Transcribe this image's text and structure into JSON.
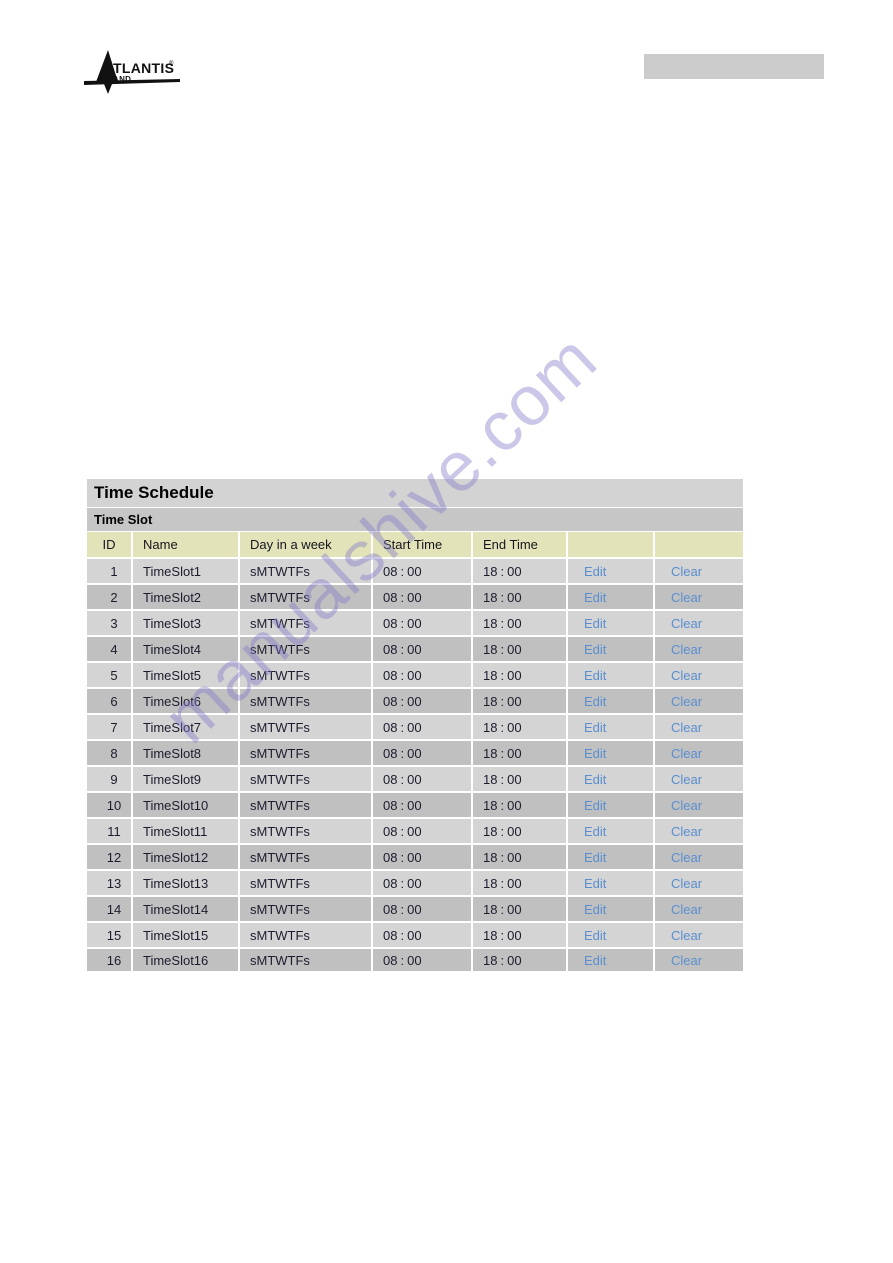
{
  "header": {
    "logo": {
      "icon": "atlantis-land-logo",
      "brand_primary": "ATLANTIS",
      "brand_registered": "®",
      "brand_secondary": "LAND"
    },
    "gray_bar_color": "#cccccc"
  },
  "watermark": {
    "text": "manualshive.com",
    "color": "#807aca"
  },
  "panel": {
    "title": "Time Schedule",
    "subtitle": "Time Slot",
    "title_bg": "#d3d3d3",
    "subtitle_bg": "#c6c6c6",
    "header_bg": "#e3e3ba",
    "row_odd_bg": "#d4d4d4",
    "row_even_bg": "#c0c0c0",
    "link_color": "#5a8ed0"
  },
  "table": {
    "columns": [
      {
        "key": "id",
        "label": "ID"
      },
      {
        "key": "name",
        "label": "Name"
      },
      {
        "key": "day",
        "label": "Day in a week"
      },
      {
        "key": "start",
        "label": "Start Time"
      },
      {
        "key": "end",
        "label": "End Time"
      },
      {
        "key": "edit",
        "label": ""
      },
      {
        "key": "clear",
        "label": ""
      }
    ],
    "actions": {
      "edit_label": "Edit",
      "clear_label": "Clear"
    },
    "time_separator": ":",
    "rows": [
      {
        "id": "1",
        "name": "TimeSlot1",
        "day": "sMTWTFs",
        "start_h": "08",
        "start_m": "00",
        "end_h": "18",
        "end_m": "00"
      },
      {
        "id": "2",
        "name": "TimeSlot2",
        "day": "sMTWTFs",
        "start_h": "08",
        "start_m": "00",
        "end_h": "18",
        "end_m": "00"
      },
      {
        "id": "3",
        "name": "TimeSlot3",
        "day": "sMTWTFs",
        "start_h": "08",
        "start_m": "00",
        "end_h": "18",
        "end_m": "00"
      },
      {
        "id": "4",
        "name": "TimeSlot4",
        "day": "sMTWTFs",
        "start_h": "08",
        "start_m": "00",
        "end_h": "18",
        "end_m": "00"
      },
      {
        "id": "5",
        "name": "TimeSlot5",
        "day": "sMTWTFs",
        "start_h": "08",
        "start_m": "00",
        "end_h": "18",
        "end_m": "00"
      },
      {
        "id": "6",
        "name": "TimeSlot6",
        "day": "sMTWTFs",
        "start_h": "08",
        "start_m": "00",
        "end_h": "18",
        "end_m": "00"
      },
      {
        "id": "7",
        "name": "TimeSlot7",
        "day": "sMTWTFs",
        "start_h": "08",
        "start_m": "00",
        "end_h": "18",
        "end_m": "00"
      },
      {
        "id": "8",
        "name": "TimeSlot8",
        "day": "sMTWTFs",
        "start_h": "08",
        "start_m": "00",
        "end_h": "18",
        "end_m": "00"
      },
      {
        "id": "9",
        "name": "TimeSlot9",
        "day": "sMTWTFs",
        "start_h": "08",
        "start_m": "00",
        "end_h": "18",
        "end_m": "00"
      },
      {
        "id": "10",
        "name": "TimeSlot10",
        "day": "sMTWTFs",
        "start_h": "08",
        "start_m": "00",
        "end_h": "18",
        "end_m": "00"
      },
      {
        "id": "11",
        "name": "TimeSlot11",
        "day": "sMTWTFs",
        "start_h": "08",
        "start_m": "00",
        "end_h": "18",
        "end_m": "00"
      },
      {
        "id": "12",
        "name": "TimeSlot12",
        "day": "sMTWTFs",
        "start_h": "08",
        "start_m": "00",
        "end_h": "18",
        "end_m": "00"
      },
      {
        "id": "13",
        "name": "TimeSlot13",
        "day": "sMTWTFs",
        "start_h": "08",
        "start_m": "00",
        "end_h": "18",
        "end_m": "00"
      },
      {
        "id": "14",
        "name": "TimeSlot14",
        "day": "sMTWTFs",
        "start_h": "08",
        "start_m": "00",
        "end_h": "18",
        "end_m": "00"
      },
      {
        "id": "15",
        "name": "TimeSlot15",
        "day": "sMTWTFs",
        "start_h": "08",
        "start_m": "00",
        "end_h": "18",
        "end_m": "00"
      },
      {
        "id": "16",
        "name": "TimeSlot16",
        "day": "sMTWTFs",
        "start_h": "08",
        "start_m": "00",
        "end_h": "18",
        "end_m": "00"
      }
    ]
  }
}
